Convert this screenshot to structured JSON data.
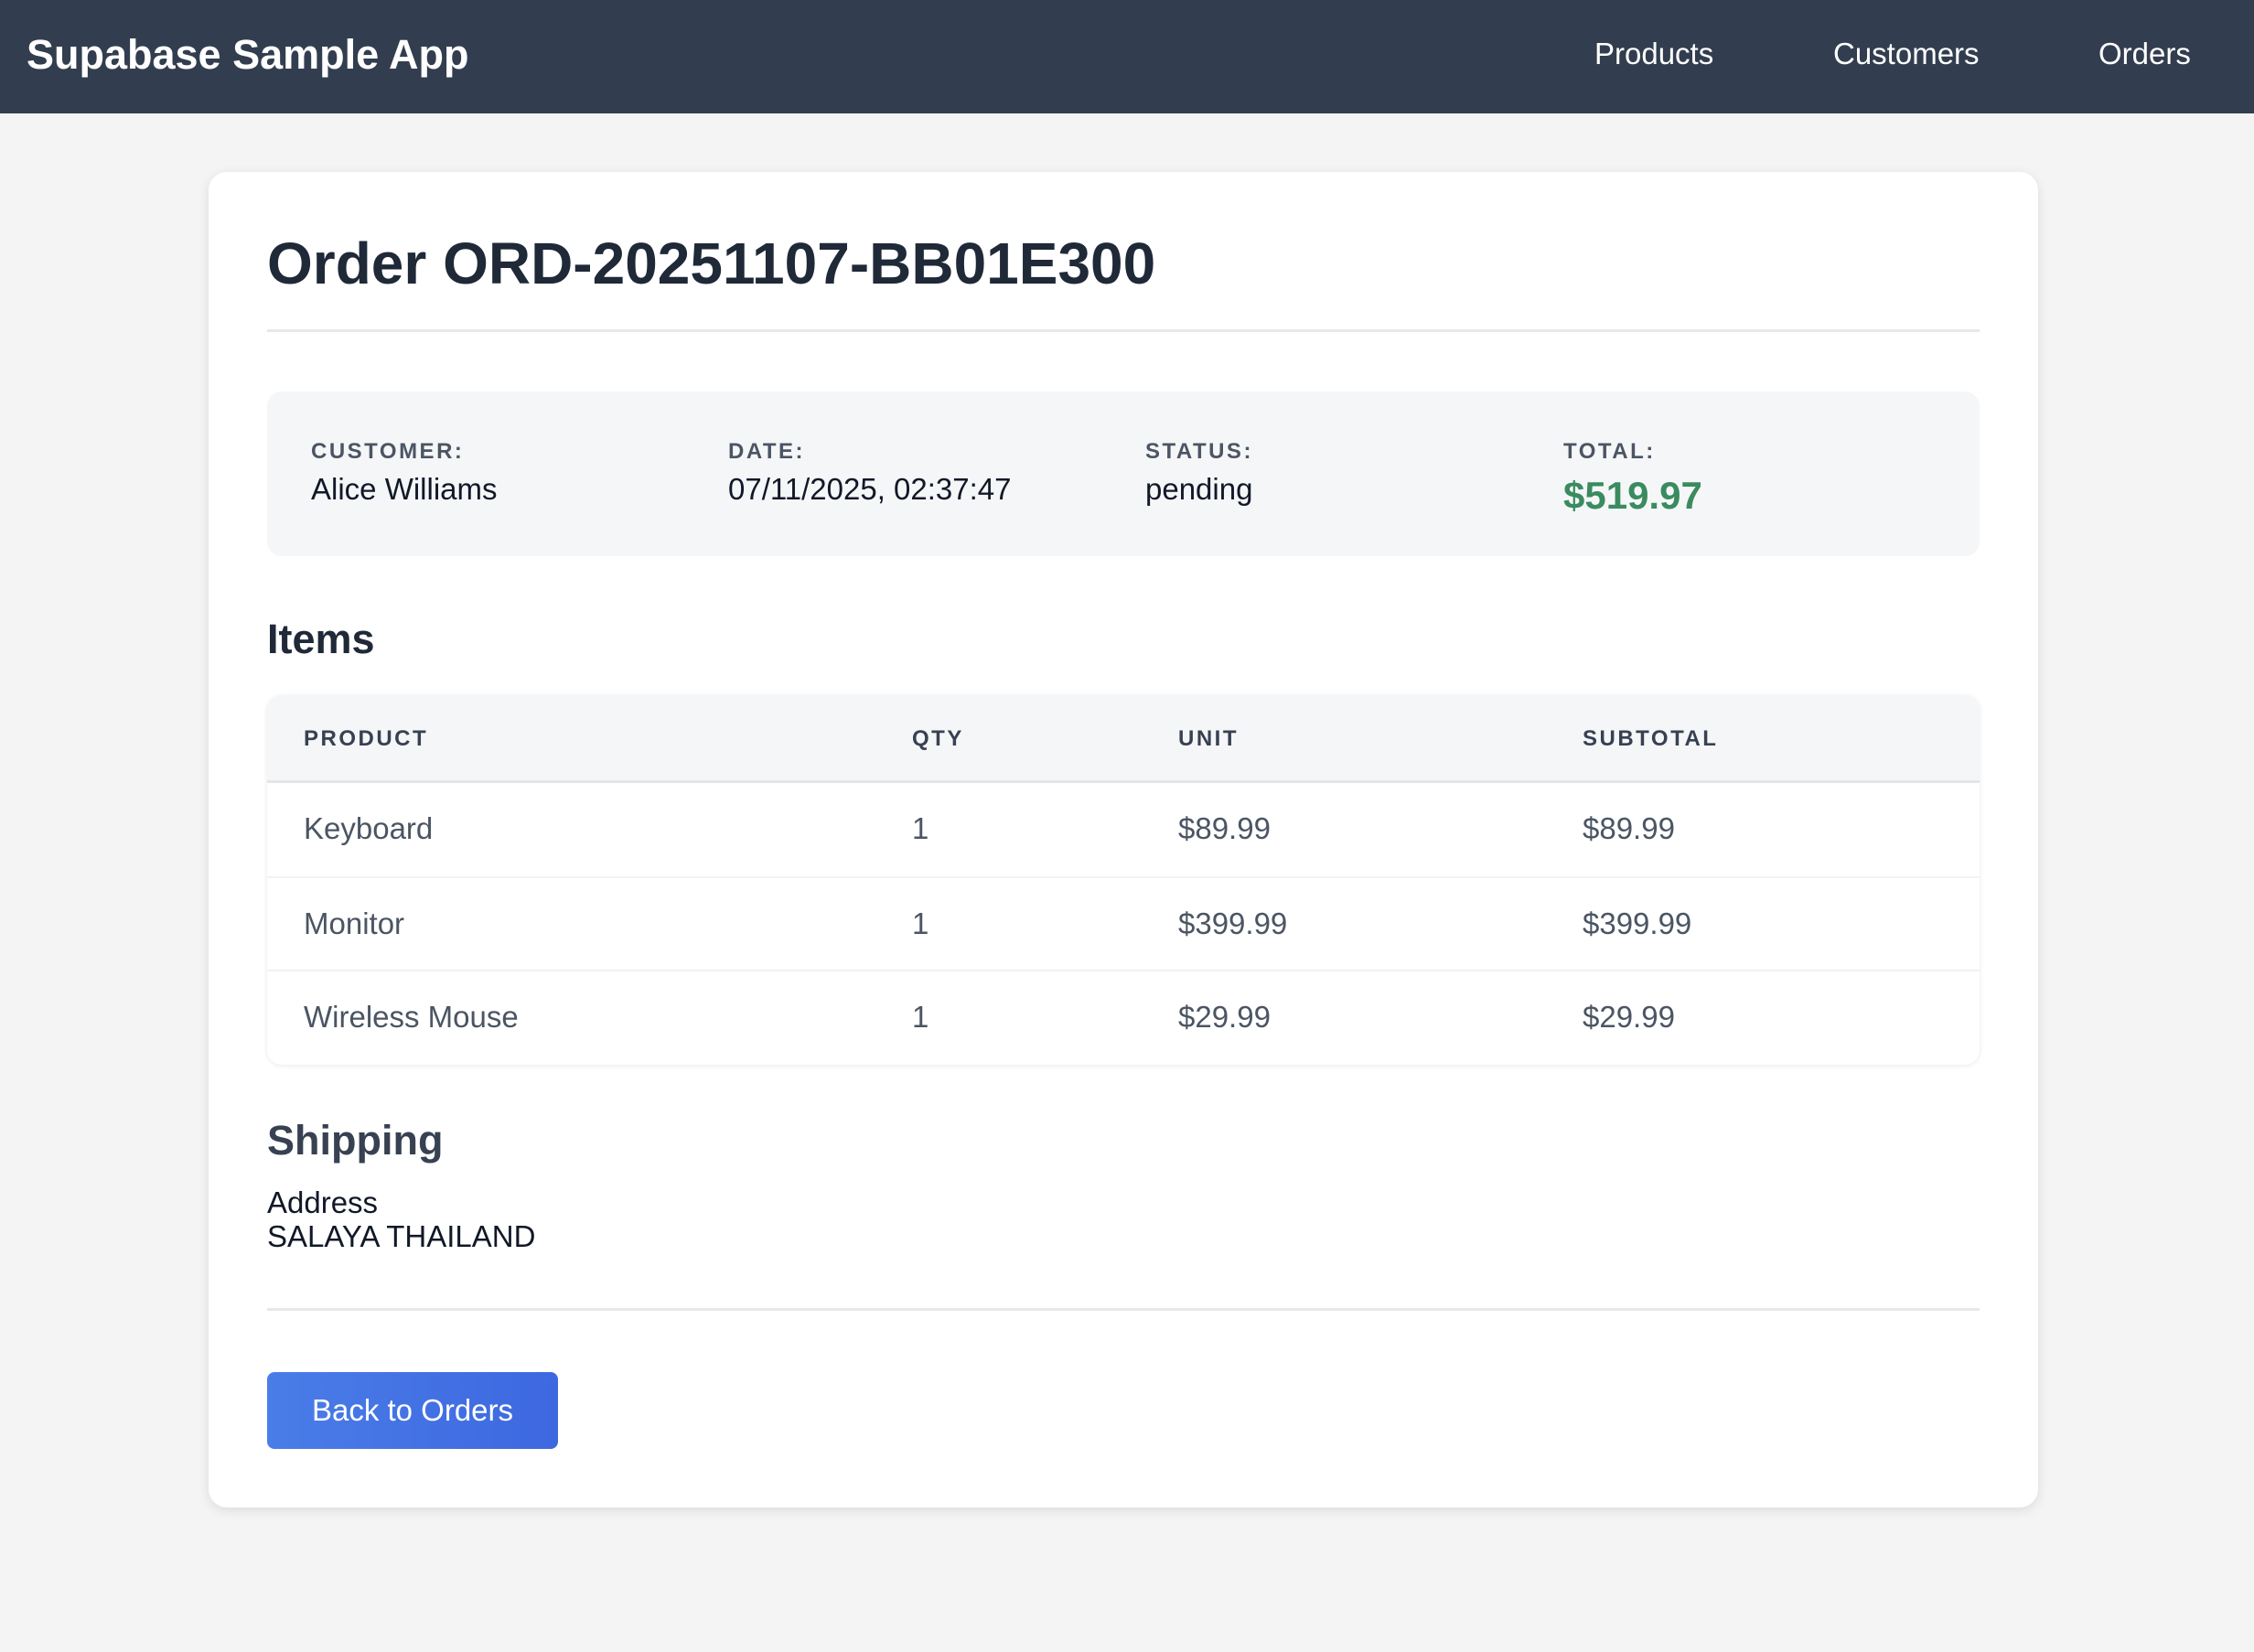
{
  "navbar": {
    "brand": "Supabase Sample App",
    "links": [
      {
        "label": "Products"
      },
      {
        "label": "Customers"
      },
      {
        "label": "Orders"
      }
    ]
  },
  "order": {
    "title": "Order ORD-20251107-BB01E300",
    "summary": {
      "customer_label": "CUSTOMER:",
      "customer": "Alice Williams",
      "date_label": "DATE:",
      "date": "07/11/2025, 02:37:47",
      "status_label": "STATUS:",
      "status": "pending",
      "total_label": "TOTAL:",
      "total": "$519.97"
    },
    "items_heading": "Items",
    "table": {
      "headers": [
        "PRODUCT",
        "QTY",
        "UNIT",
        "SUBTOTAL"
      ],
      "rows": [
        {
          "product": "Keyboard",
          "qty": "1",
          "unit": "$89.99",
          "subtotal": "$89.99"
        },
        {
          "product": "Monitor",
          "qty": "1",
          "unit": "$399.99",
          "subtotal": "$399.99"
        },
        {
          "product": "Wireless Mouse",
          "qty": "1",
          "unit": "$29.99",
          "subtotal": "$29.99"
        }
      ]
    },
    "shipping": {
      "heading": "Shipping",
      "address_label": "Address",
      "address": "SALAYA THAILAND"
    },
    "back_button_label": "Back to Orders"
  },
  "colors": {
    "navbar_bg": "#323e4f",
    "total_green": "#3a8b5f",
    "button_blue": "#4271e4",
    "page_bg": "#f4f4f4"
  }
}
